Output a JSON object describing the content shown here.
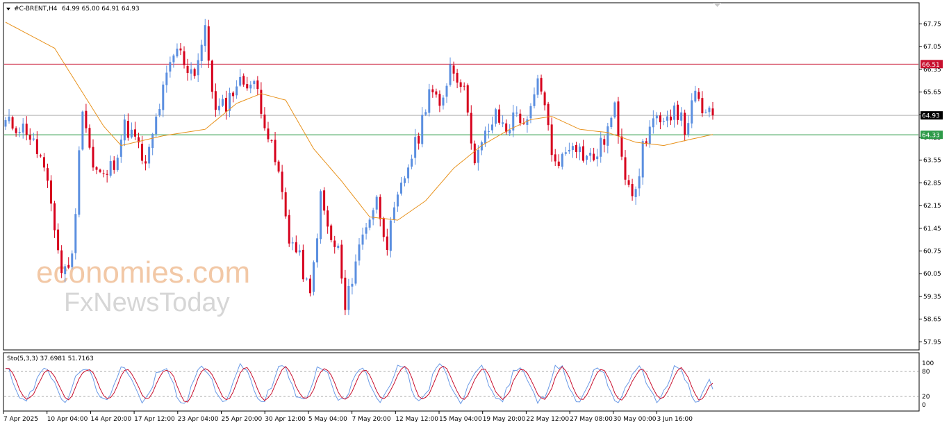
{
  "header": {
    "symbol": "#C-BRENT,H4",
    "ohlc": "64.99 65.00 64.91 64.93"
  },
  "indicator": {
    "label": "Sto(5,3,3) 37.6981 51.7163",
    "levels": [
      "100",
      "80",
      "20",
      "0"
    ]
  },
  "watermark": {
    "line1": "economies.com",
    "line2": "FxNewsToday"
  },
  "colors": {
    "bull": "#5b8fe0",
    "bear": "#d6001c",
    "ma": "#e8921c",
    "resistance": "#c8102e",
    "support": "#2e9a48",
    "price_line": "#b0b0b0",
    "stoch_main": "#6a9ae6",
    "stoch_signal": "#c8102e",
    "grid_level": "#a8a8a8"
  },
  "chart_data": [
    {
      "type": "candlestick",
      "title": "#C-BRENT,H4",
      "ylim": [
        57.7,
        68.4
      ],
      "y_ticks": [
        "67.75",
        "67.05",
        "66.35",
        "65.65",
        "64.95",
        "64.25",
        "63.55",
        "62.85",
        "62.15",
        "61.45",
        "60.75",
        "60.05",
        "59.35",
        "58.65",
        "57.95"
      ],
      "x_ticks": [
        "7 Apr 2025",
        "10 Apr 04:00",
        "14 Apr 20:00",
        "17 Apr 12:00",
        "23 Apr 04:00",
        "25 Apr 20:00",
        "30 Apr 12:00",
        "5 May 04:00",
        "7 May 20:00",
        "12 May 12:00",
        "15 May 04:00",
        "19 May 20:00",
        "22 May 12:00",
        "27 May 08:00",
        "30 May 00:00",
        "3 Jun 16:00"
      ],
      "current_price": 64.93,
      "horizontal_lines": [
        {
          "label": "66.51",
          "value": 66.51,
          "color": "#c8102e"
        },
        {
          "label": "64.33",
          "value": 64.33,
          "color": "#2e9a48"
        }
      ],
      "close_path": [
        [
          0,
          64.7
        ],
        [
          6,
          64.5
        ],
        [
          10,
          63.6
        ],
        [
          13,
          62.2
        ],
        [
          16,
          60.1
        ],
        [
          19,
          60.5
        ],
        [
          22,
          65.3
        ],
        [
          25,
          63.3
        ],
        [
          28,
          63.0
        ],
        [
          31,
          63.5
        ],
        [
          34,
          64.6
        ],
        [
          37,
          64.2
        ],
        [
          40,
          63.3
        ],
        [
          43,
          64.8
        ],
        [
          46,
          66.1
        ],
        [
          49,
          67.0
        ],
        [
          52,
          66.4
        ],
        [
          54,
          66.3
        ],
        [
          57,
          67.5
        ],
        [
          60,
          65.0
        ],
        [
          63,
          65.3
        ],
        [
          66,
          65.9
        ],
        [
          69,
          66.0
        ],
        [
          72,
          65.7
        ],
        [
          75,
          64.3
        ],
        [
          78,
          63.1
        ],
        [
          81,
          61.2
        ],
        [
          84,
          60.5
        ],
        [
          87,
          59.3
        ],
        [
          90,
          62.4
        ],
        [
          93,
          61.0
        ],
        [
          95,
          60.8
        ],
        [
          97,
          58.9
        ],
        [
          100,
          60.5
        ],
        [
          103,
          61.6
        ],
        [
          106,
          62.3
        ],
        [
          109,
          61.0
        ],
        [
          112,
          62.3
        ],
        [
          115,
          63.4
        ],
        [
          118,
          64.3
        ],
        [
          121,
          65.8
        ],
        [
          124,
          65.1
        ],
        [
          127,
          66.5
        ],
        [
          130,
          66.0
        ],
        [
          132,
          65.2
        ],
        [
          134,
          63.4
        ],
        [
          137,
          64.3
        ],
        [
          140,
          64.9
        ],
        [
          143,
          64.5
        ],
        [
          146,
          65.0
        ],
        [
          149,
          64.6
        ],
        [
          152,
          65.9
        ],
        [
          154,
          65.4
        ],
        [
          156,
          63.6
        ],
        [
          159,
          63.6
        ],
        [
          162,
          64.2
        ],
        [
          165,
          63.7
        ],
        [
          168,
          63.6
        ],
        [
          171,
          64.2
        ],
        [
          174,
          65.1
        ],
        [
          177,
          63.2
        ],
        [
          180,
          62.4
        ],
        [
          182,
          64.0
        ],
        [
          185,
          64.8
        ],
        [
          188,
          64.5
        ],
        [
          191,
          65.3
        ],
        [
          194,
          64.5
        ],
        [
          197,
          65.5
        ],
        [
          200,
          64.9
        ],
        [
          202,
          64.93
        ]
      ],
      "moving_average": [
        [
          0,
          67.8
        ],
        [
          14,
          67.0
        ],
        [
          28,
          64.6
        ],
        [
          33,
          64.0
        ],
        [
          45,
          64.3
        ],
        [
          57,
          64.5
        ],
        [
          66,
          65.3
        ],
        [
          73,
          65.6
        ],
        [
          80,
          65.4
        ],
        [
          88,
          63.9
        ],
        [
          96,
          62.9
        ],
        [
          104,
          61.8
        ],
        [
          112,
          61.7
        ],
        [
          120,
          62.3
        ],
        [
          128,
          63.3
        ],
        [
          136,
          64.0
        ],
        [
          144,
          64.5
        ],
        [
          150,
          64.8
        ],
        [
          156,
          64.9
        ],
        [
          164,
          64.5
        ],
        [
          172,
          64.4
        ],
        [
          180,
          64.1
        ],
        [
          188,
          64.0
        ],
        [
          196,
          64.2
        ],
        [
          202,
          64.34
        ]
      ],
      "candle_count": 203
    },
    {
      "type": "line",
      "title": "Sto(5,3,3) 37.6981 51.7163",
      "ylim": [
        0,
        100
      ],
      "levels": [
        20,
        80
      ],
      "series": [
        {
          "name": "37.6981",
          "period_approx": 11.3
        },
        {
          "name": "51.7163",
          "lag": 1.3
        }
      ]
    }
  ]
}
